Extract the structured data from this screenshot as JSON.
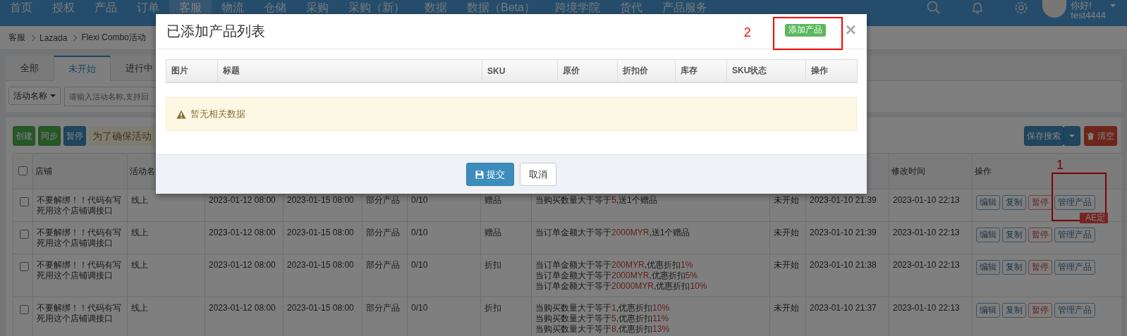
{
  "nav": {
    "items": [
      {
        "label": "首页",
        "selected": false
      },
      {
        "label": "授权",
        "selected": false
      },
      {
        "label": "产品",
        "selected": false
      },
      {
        "label": "订单",
        "selected": false
      },
      {
        "label": "客服",
        "selected": true
      },
      {
        "label": "物流",
        "selected": false
      },
      {
        "label": "仓储",
        "selected": false
      },
      {
        "label": "采购",
        "selected": false
      },
      {
        "label": "采购（新）",
        "selected": false
      },
      {
        "label": "数据",
        "selected": false
      },
      {
        "label": "数据（Beta）",
        "selected": false
      },
      {
        "label": "跨境学院",
        "selected": false
      },
      {
        "label": "货代",
        "selected": false
      },
      {
        "label": "产品服务",
        "selected": false
      }
    ],
    "greeting": "你好!",
    "username": "test4444"
  },
  "breadcrumb": [
    "客服",
    "Lazada",
    "Flexi Combo活动"
  ],
  "tabs": [
    {
      "label": "全部",
      "selected": false
    },
    {
      "label": "未开始",
      "selected": true
    },
    {
      "label": "进行中",
      "selected": false
    }
  ],
  "filter": {
    "field": "活动名称",
    "placeholder": "请输入活动名称,支持回"
  },
  "toolbar": {
    "buttons": [
      {
        "label": "创建",
        "kind": "success"
      },
      {
        "label": "同步",
        "kind": "success"
      },
      {
        "label": "暂停",
        "kind": "primary"
      }
    ],
    "notice": "为了确保活动",
    "right_buttons": [
      {
        "label": "保存搜索",
        "kind": "primary",
        "dropdown": true
      },
      {
        "label": "清空",
        "kind": "danger",
        "dropdown": false
      }
    ]
  },
  "table": {
    "select_all": false,
    "header_left": [
      "店铺",
      "活动名"
    ],
    "header_right": [
      "修改时间",
      "操作"
    ],
    "rows": [
      {
        "checked": false,
        "shop": "不要解绑！！代码有写死用这个店铺调接口",
        "channel": "线上",
        "start": "2023-01-12 08:00",
        "end": "2023-01-15 08:00",
        "scope": "部分产品",
        "count": "0/10",
        "type": "赠品",
        "rules": [
          "当购买数量大于等于**5**,送1个赠品"
        ],
        "status": "未开始",
        "created": "2023-01-10 21:39",
        "modified": "2023-01-10 22:13",
        "actions": [
          {
            "label": "编辑",
            "kind": "default"
          },
          {
            "label": "复制",
            "kind": "default"
          },
          {
            "label": "暂停",
            "kind": "danger"
          },
          {
            "label": "管理产品",
            "kind": "default",
            "annotation": "1",
            "tag": "AE定"
          }
        ]
      },
      {
        "checked": false,
        "shop": "不要解绑！！代码有写死用这个店铺调接口",
        "channel": "线上",
        "start": "2023-01-12 08:00",
        "end": "2023-01-15 08:00",
        "scope": "部分产品",
        "count": "0/10",
        "type": "赠品",
        "rules": [
          "当订单金额大于等于**2000MYR**,送1个赠品"
        ],
        "status": "未开始",
        "created": "2023-01-10 21:39",
        "modified": "2023-01-10 22:13",
        "actions": [
          {
            "label": "编辑",
            "kind": "default"
          },
          {
            "label": "复制",
            "kind": "default"
          },
          {
            "label": "暂停",
            "kind": "danger"
          },
          {
            "label": "管理产品",
            "kind": "default"
          }
        ]
      },
      {
        "checked": false,
        "shop": "不要解绑！！代码有写死用这个店铺调接口",
        "channel": "线上",
        "start": "2023-01-12 08:00",
        "end": "2023-01-15 08:00",
        "scope": "部分产品",
        "count": "0/10",
        "type": "折扣",
        "rules": [
          "当订单金额大于等于**200MYR**,优惠折扣**1%**",
          "当订单金额大于等于**2000MYR**,优惠折扣**5%**",
          "当订单金额大于等于**20000MYR**,优惠折扣**10%**"
        ],
        "status": "未开始",
        "created": "2023-01-10 21:38",
        "modified": "2023-01-10 22:13",
        "actions": [
          {
            "label": "编辑",
            "kind": "default"
          },
          {
            "label": "复制",
            "kind": "default"
          },
          {
            "label": "暂停",
            "kind": "danger"
          },
          {
            "label": "管理产品",
            "kind": "default"
          }
        ]
      },
      {
        "checked": false,
        "shop": "不要解绑！！代码有写死用这个店铺调接口",
        "channel": "线上",
        "start": "2023-01-12 08:00",
        "end": "2023-01-15 08:00",
        "scope": "部分产品",
        "count": "0/10",
        "type": "折扣",
        "rules": [
          "当购买数量大于等于**1**,优惠折扣**10%**",
          "当购买数量大于等于**5**,优惠折扣**11%**",
          "当购买数量大于等于**8**,优惠折扣**13%**"
        ],
        "status": "未开始",
        "created": "2023-01-10 21:37",
        "modified": "2023-01-10 22:13",
        "actions": [
          {
            "label": "编辑",
            "kind": "default"
          },
          {
            "label": "复制",
            "kind": "default"
          },
          {
            "label": "暂停",
            "kind": "danger"
          },
          {
            "label": "管理产品",
            "kind": "default"
          }
        ]
      }
    ]
  },
  "modal": {
    "title": "已添加产品列表",
    "annotation": "2",
    "add_button": "添加产品",
    "close": "×",
    "columns": [
      "图片",
      "标题",
      "SKU",
      "原价",
      "折扣价",
      "库存",
      "SKU状态",
      "操作"
    ],
    "empty": "暂无相关数据",
    "buttons": [
      {
        "label": "提交",
        "kind": "primary"
      },
      {
        "label": "取消",
        "kind": "default"
      }
    ]
  }
}
